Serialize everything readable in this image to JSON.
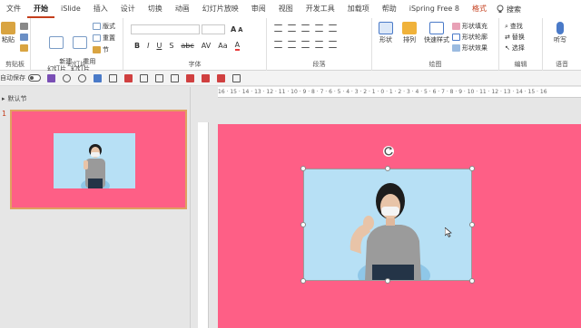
{
  "menu": {
    "tabs": [
      "文件",
      "开始",
      "iSlide",
      "插入",
      "设计",
      "切换",
      "动画",
      "幻灯片放映",
      "审阅",
      "视图",
      "开发工具",
      "加载项",
      "帮助",
      "iSpring Free 8",
      "格式"
    ],
    "active": "开始",
    "search_placeholder": "搜索"
  },
  "ribbon": {
    "clipboard": {
      "paste": "粘贴",
      "label": "剪贴板"
    },
    "slides": {
      "new_slide": "新建\n幻灯片",
      "reuse_slide": "重用\n幻灯片",
      "layout": "版式",
      "reset": "重置",
      "section": "节",
      "label": "幻灯片"
    },
    "font": {
      "label": "字体",
      "bold": "B",
      "italic": "I",
      "underline": "U",
      "shadow": "S",
      "strike": "abc",
      "spacing": "AV",
      "case": "Aa",
      "font_color": "A"
    },
    "paragraph": {
      "label": "段落"
    },
    "drawing": {
      "shapes": "形状",
      "arrange": "排列",
      "quick_styles": "快速样式",
      "fill": "形状填充",
      "outline": "形状轮廓",
      "effects": "形状效果",
      "label": "绘图"
    },
    "editing": {
      "find": "查找",
      "replace": "替换",
      "select": "选择",
      "label": "编辑"
    },
    "voice": {
      "dictate": "听写",
      "label": "语音"
    }
  },
  "qat": {
    "autosave": "自动保存",
    "autosave_state": "off"
  },
  "thumbnails": {
    "section": "默认节",
    "slide_number": "1"
  },
  "ruler": {
    "horizontal": "16 · 15 · 14 · 13 · 12 · 11 · 10 · 9 · 8 · 7 · 6 · 5 · 4 · 3 · 2 · 1 · 0 · 1 · 2 · 3 · 4 · 5 · 6 · 7 · 8 · 9 · 10 · 11 · 12 · 13 · 14 · 15 · 16"
  },
  "colors": {
    "slide_bg": "#fe5f86",
    "picture_bg": "#b7e0f5",
    "accent": "#c43e1c"
  }
}
